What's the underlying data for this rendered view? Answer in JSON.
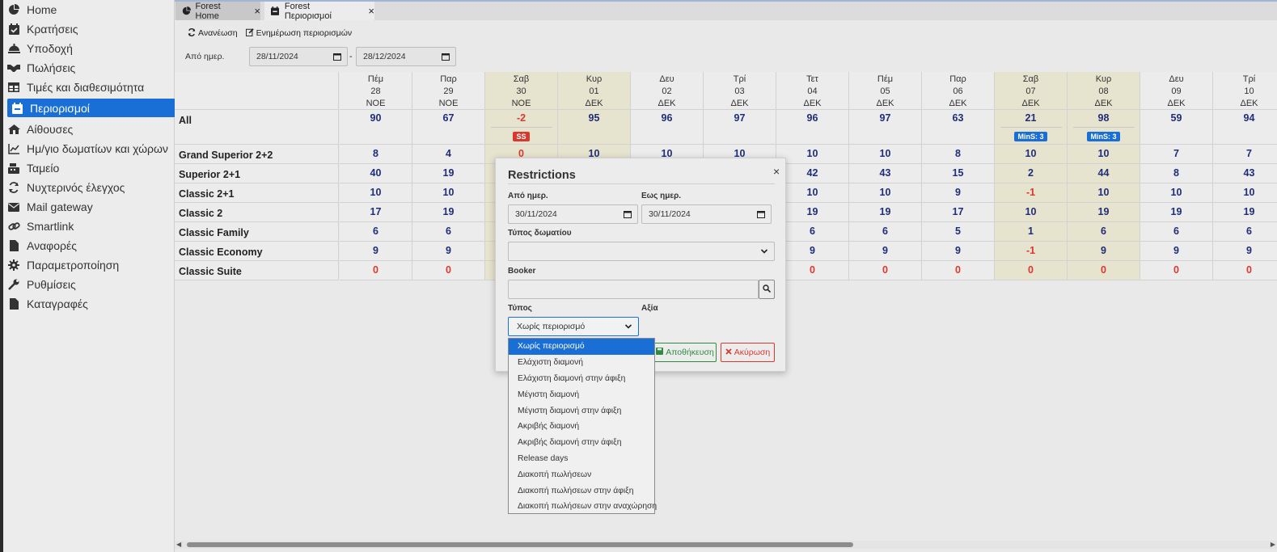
{
  "sidebar": {
    "items": [
      {
        "label": "Home",
        "icon": "home-pie-icon"
      },
      {
        "label": "Κρατήσεις",
        "icon": "calendar-check-icon"
      },
      {
        "label": "Υποδοχή",
        "icon": "bell-icon"
      },
      {
        "label": "Πωλήσεις",
        "icon": "handshake-icon"
      },
      {
        "label": "Τιμές και διαθεσιμότητα",
        "icon": "table-icon"
      },
      {
        "label": "Περιορισμοί",
        "icon": "calendar-x-icon",
        "active": true
      },
      {
        "label": "Αίθουσες",
        "icon": "building-icon"
      },
      {
        "label": "Ημ/γιο δωματίων και χώρων",
        "icon": "chart-icon"
      },
      {
        "label": "Ταμείο",
        "icon": "cash-register-icon"
      },
      {
        "label": "Νυχτερινός έλεγχος",
        "icon": "sync-icon"
      },
      {
        "label": "Mail gateway",
        "icon": "envelope-icon"
      },
      {
        "label": "Smartlink",
        "icon": "link-icon"
      },
      {
        "label": "Αναφορές",
        "icon": "file-icon"
      },
      {
        "label": "Παραμετροποίηση",
        "icon": "gear-icon"
      },
      {
        "label": "Ρυθμίσεις",
        "icon": "wrench-icon"
      },
      {
        "label": "Καταγραφές",
        "icon": "file-icon"
      }
    ]
  },
  "tabs": [
    {
      "label": "Forest Home",
      "close": "×"
    },
    {
      "label": "Forest Περιορισμοί",
      "close": "×"
    }
  ],
  "toolbar": {
    "refresh_label": "Ανανέωση",
    "update_label": "Ενημέρωση περιορισμών"
  },
  "filters": {
    "from_label": "Από ημερ.",
    "from_value": "28/11/2024",
    "separator": "-",
    "to_value": "28/12/2024"
  },
  "grid": {
    "dates": [
      {
        "dow": "Πέμ",
        "day": "28",
        "month": "ΝΟΕ",
        "weekend": false
      },
      {
        "dow": "Παρ",
        "day": "29",
        "month": "ΝΟΕ",
        "weekend": false
      },
      {
        "dow": "Σαβ",
        "day": "30",
        "month": "ΝΟΕ",
        "weekend": true
      },
      {
        "dow": "Κυρ",
        "day": "01",
        "month": "ΔΕΚ",
        "weekend": true
      },
      {
        "dow": "Δευ",
        "day": "02",
        "month": "ΔΕΚ",
        "weekend": false
      },
      {
        "dow": "Τρί",
        "day": "03",
        "month": "ΔΕΚ",
        "weekend": false
      },
      {
        "dow": "Τετ",
        "day": "04",
        "month": "ΔΕΚ",
        "weekend": false
      },
      {
        "dow": "Πέμ",
        "day": "05",
        "month": "ΔΕΚ",
        "weekend": false
      },
      {
        "dow": "Παρ",
        "day": "06",
        "month": "ΔΕΚ",
        "weekend": false
      },
      {
        "dow": "Σαβ",
        "day": "07",
        "month": "ΔΕΚ",
        "weekend": true
      },
      {
        "dow": "Κυρ",
        "day": "08",
        "month": "ΔΕΚ",
        "weekend": true
      },
      {
        "dow": "Δευ",
        "day": "09",
        "month": "ΔΕΚ",
        "weekend": false
      },
      {
        "dow": "Τρί",
        "day": "10",
        "month": "ΔΕΚ",
        "weekend": false
      }
    ],
    "all_row": {
      "label": "All",
      "values": [
        "90",
        "67",
        "-2",
        "95",
        "96",
        "97",
        "96",
        "97",
        "63",
        "21",
        "98",
        "59",
        "94"
      ],
      "badges": [
        "",
        "",
        "SS",
        "",
        "",
        "",
        "",
        "",
        "",
        "MinS: 3",
        "MinS: 3",
        "",
        ""
      ]
    },
    "rows": [
      {
        "label": "Grand Superior 2+2",
        "values": [
          "8",
          "4",
          "0",
          "10",
          "10",
          "10",
          "10",
          "10",
          "8",
          "10",
          "10",
          "7",
          "7"
        ]
      },
      {
        "label": "Superior 2+1",
        "values": [
          "40",
          "19",
          "",
          "",
          "",
          "",
          "42",
          "43",
          "15",
          "2",
          "44",
          "8",
          "43"
        ]
      },
      {
        "label": "Classic 2+1",
        "values": [
          "10",
          "10",
          "",
          "",
          "",
          "",
          "10",
          "10",
          "9",
          "-1",
          "10",
          "10",
          "10"
        ]
      },
      {
        "label": "Classic 2",
        "values": [
          "17",
          "19",
          "",
          "",
          "",
          "",
          "19",
          "19",
          "17",
          "10",
          "19",
          "19",
          "19"
        ]
      },
      {
        "label": "Classic Family",
        "values": [
          "6",
          "6",
          "",
          "",
          "",
          "",
          "6",
          "6",
          "5",
          "1",
          "6",
          "6",
          "6"
        ]
      },
      {
        "label": "Classic Economy",
        "values": [
          "9",
          "9",
          "",
          "",
          "",
          "",
          "9",
          "9",
          "9",
          "-1",
          "9",
          "9",
          "9"
        ]
      },
      {
        "label": "Classic Suite",
        "values": [
          "0",
          "0",
          "",
          "",
          "",
          "",
          "0",
          "0",
          "0",
          "0",
          "0",
          "0",
          "0"
        ]
      }
    ]
  },
  "modal": {
    "title": "Restrictions",
    "close": "×",
    "from_label": "Από ημερ.",
    "from_value": "30/11/2024",
    "to_label": "Εως ημερ.",
    "to_value": "30/11/2024",
    "room_type_label": "Τύπος δωματίου",
    "room_type_value": "",
    "booker_label": "Booker",
    "booker_value": "",
    "type_label": "Τύπος",
    "type_value": "Χωρίς περιορισμό",
    "value_label": "Αξία",
    "save_label": "Αποθήκευση",
    "cancel_label": "Ακύρωση"
  },
  "dropdown": {
    "options": [
      "Χωρίς περιορισμό",
      "Ελάχιστη διαμονή",
      "Ελάχιστη διαμονή στην άφιξη",
      "Μέγιστη διαμονή",
      "Μέγιστη διαμονή στην άφιξη",
      "Ακριβής διαμονή",
      "Ακριβής διαμονή στην άφιξη",
      "Release days",
      "Διακοπή πωλήσεων",
      "Διακοπή πωλήσεων στην άφιξη",
      "Διακοπή πωλήσεων στην αναχώρηση"
    ],
    "selected_index": 0
  },
  "colors": {
    "accent": "#1a6fd6",
    "negative": "#d9392c",
    "value": "#1f2d7a",
    "weekend": "#e6e3cf",
    "save": "#2e8b40"
  }
}
